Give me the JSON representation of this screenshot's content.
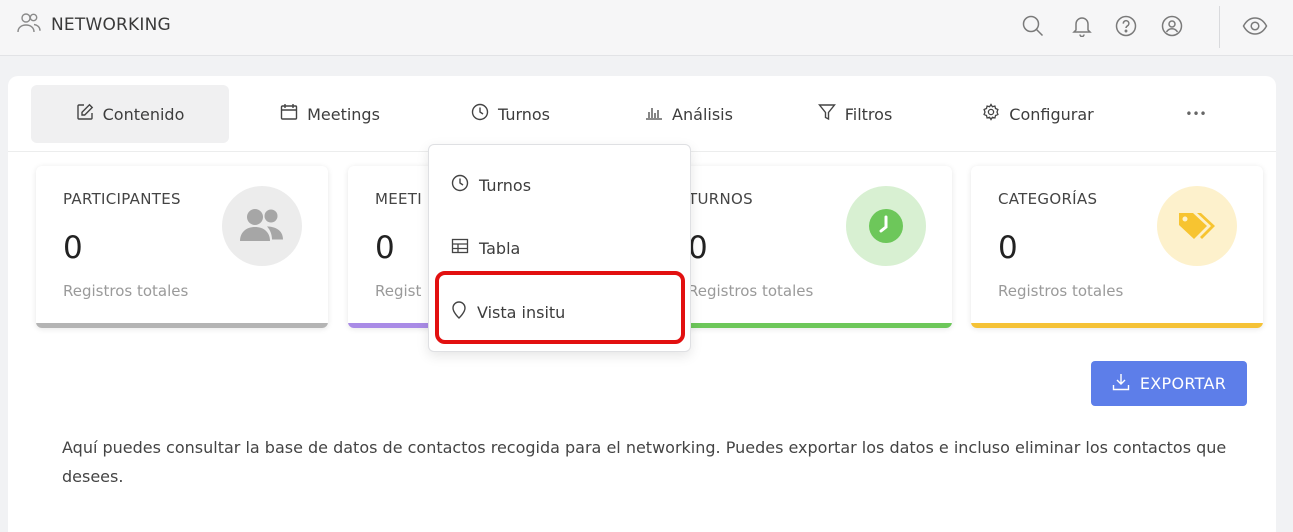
{
  "header": {
    "title": "NETWORKING",
    "icons": [
      "people-outline-icon",
      "search-icon",
      "bell-icon",
      "help-icon",
      "user-circle-icon",
      "eye-icon"
    ]
  },
  "tabs": [
    {
      "label": "Contenido",
      "icon": "edit-icon",
      "active": true
    },
    {
      "label": "Meetings",
      "icon": "calendar-icon",
      "active": false
    },
    {
      "label": "Turnos",
      "icon": "clock-icon",
      "active": false
    },
    {
      "label": "Análisis",
      "icon": "bar-chart-icon",
      "active": false
    },
    {
      "label": "Filtros",
      "icon": "filter-icon",
      "active": false
    },
    {
      "label": "Configurar",
      "icon": "settings-icon",
      "active": false
    },
    {
      "label": "•••",
      "icon": "more-icon",
      "active": false
    }
  ],
  "cards": [
    {
      "title": "PARTICIPANTES",
      "value": "0",
      "subtitle": "Registros totales",
      "icon": "users-icon",
      "bar_color": "#b4b4b4",
      "icon_bg": "#ececec",
      "icon_color": "#a6a6a6"
    },
    {
      "title": "MEETI",
      "value": "0",
      "subtitle": "Regist",
      "bar_color": "#a98be6"
    },
    {
      "title": "TURNOS",
      "value": "0",
      "subtitle": "Registros totales",
      "icon": "clock-icon",
      "bar_color": "#6dc75a",
      "icon_bg": "#d8f0d2",
      "icon_color": "#6dc75a"
    },
    {
      "title": "CATEGORÍAS",
      "value": "0",
      "subtitle": "Registros totales",
      "icon": "tag-icon",
      "bar_color": "#f5c236",
      "icon_bg": "#fdf1cc",
      "icon_color": "#f7c431"
    }
  ],
  "dropdown": {
    "items": [
      {
        "label": "Turnos",
        "icon": "clock-icon"
      },
      {
        "label": "Tabla",
        "icon": "table-icon"
      },
      {
        "label": "Vista insitu",
        "icon": "location-pin-icon",
        "highlighted": true
      }
    ]
  },
  "export": {
    "label": "EXPORTAR",
    "color": "#5d7ee9"
  },
  "description": "Aquí puedes consultar la base de datos de contactos recogida para el networking. Puedes exportar los datos e incluso eliminar los contactos que desees.",
  "colors": {
    "highlight": "#e21010",
    "accent": "#5d7ee9"
  }
}
